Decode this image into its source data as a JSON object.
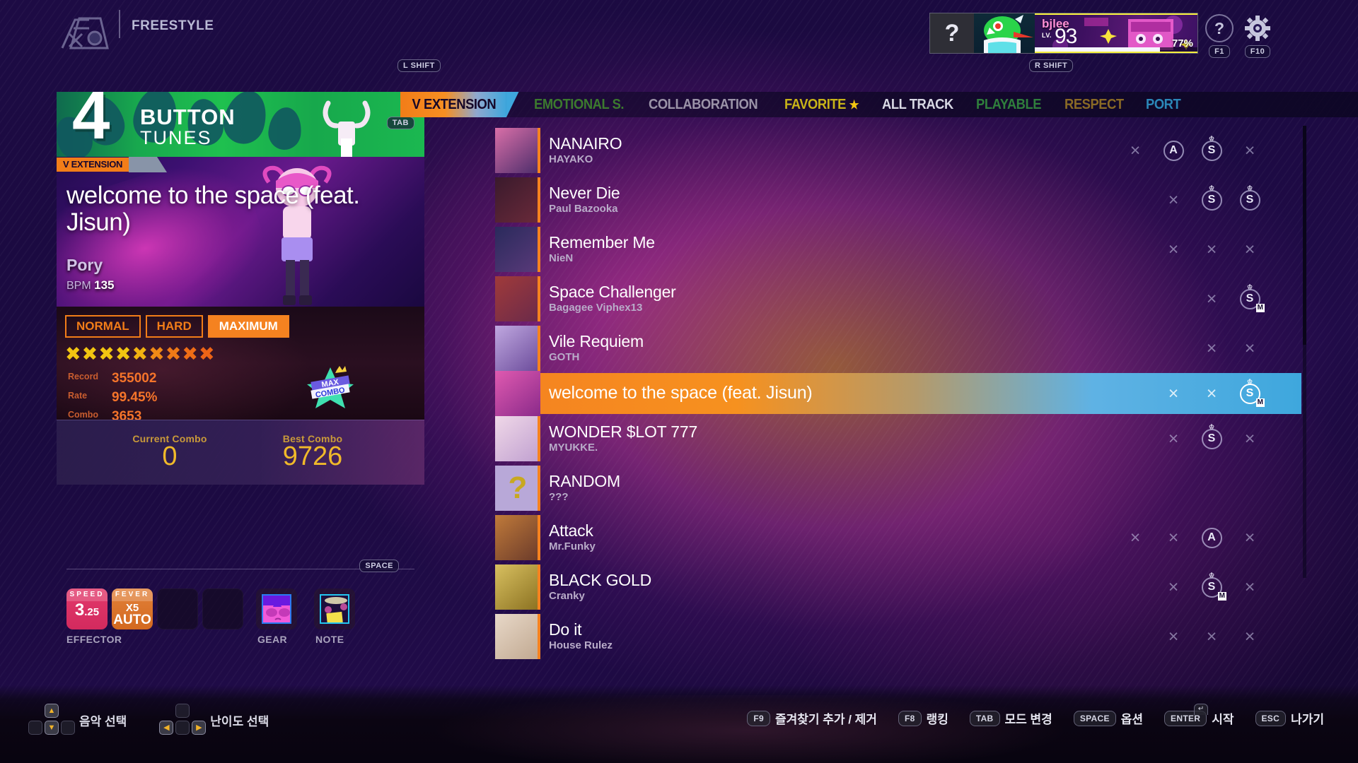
{
  "topbar": {
    "mode_label": "FREESTYLE",
    "mode_icon": "freestyle-mode-icon",
    "help_icon": "question-mark-icon",
    "help_key": "F1",
    "settings_icon": "gear-icon",
    "settings_key": "F10"
  },
  "profile": {
    "unknown_icon": "?",
    "name": "bjlee",
    "lv_label": "LV.",
    "level": "93",
    "percent": "77%",
    "progress": 77
  },
  "tunes": {
    "count": "4",
    "button_label": "BUTTON",
    "tunes_label": "TUNES",
    "tab_key": "TAB"
  },
  "now_playing": {
    "category": "V EXTENSION",
    "title": "welcome to the space (feat. Jisun)",
    "artist": "Pory",
    "bpm_label": "BPM",
    "bpm_value": "135"
  },
  "difficulty": {
    "buttons": [
      {
        "label": "NORMAL",
        "active": false
      },
      {
        "label": "HARD",
        "active": false
      },
      {
        "label": "MAXIMUM",
        "active": true
      }
    ],
    "star_count": 9,
    "star_colors": [
      "#f2c511",
      "#f2c511",
      "#f2c511",
      "#f2c511",
      "#f2b211",
      "#f08a16",
      "#ef7a16",
      "#ee6d16",
      "#ed6416"
    ],
    "records": [
      {
        "label": "Record",
        "value": "355002"
      },
      {
        "label": "Rate",
        "value": "99.45%"
      },
      {
        "label": "Combo",
        "value": "3653"
      }
    ],
    "max_combo_badge": [
      "MAX",
      "COMBO"
    ]
  },
  "combo_panel": {
    "current_label": "Current Combo",
    "current_value": "0",
    "best_label": "Best Combo",
    "best_value": "9726"
  },
  "effector": {
    "space_key": "SPACE",
    "effector_label": "EFFECTOR",
    "gear_label": "GEAR",
    "note_label": "NOTE",
    "speed": {
      "title": "SPEED",
      "value": "3",
      "decimal": ".25"
    },
    "fever": {
      "title": "FEVER",
      "multiplier": "X5",
      "mode": "AUTO"
    }
  },
  "tabs": {
    "left_shift_key": "L SHIFT",
    "right_shift_key": "R SHIFT",
    "items": [
      {
        "label": "V EXTENSION",
        "active": true,
        "color": "#150728"
      },
      {
        "label": "EMOTIONAL S.",
        "active": false,
        "color": "#3c7a2e"
      },
      {
        "label": "COLLABORATION",
        "active": false,
        "color": "#9b93a8"
      },
      {
        "label": "FAVORITE",
        "active": false,
        "color": "#c8b418",
        "star": "★",
        "star_color": "#f2c511"
      },
      {
        "label": "ALL TRACK",
        "active": false,
        "color": "#d8d8e4"
      },
      {
        "label": "PLAYABLE",
        "active": false,
        "color": "#2f7f3c"
      },
      {
        "label": "RESPECT",
        "active": false,
        "color": "#8a6a25"
      },
      {
        "label": "PORT",
        "active": false,
        "color": "#2b87b8"
      }
    ]
  },
  "songlist": [
    {
      "title": "NANAIRO",
      "artist": "HAYAKO",
      "selected": false,
      "marks": [
        {
          "type": "x"
        },
        {
          "type": "rank",
          "label": "A"
        },
        {
          "type": "rank",
          "label": "S",
          "crown": true
        },
        {
          "type": "x"
        }
      ]
    },
    {
      "title": "Never Die",
      "artist": "Paul Bazooka",
      "selected": false,
      "marks": [
        {
          "type": "x"
        },
        {
          "type": "rank",
          "label": "S",
          "crown": true
        },
        {
          "type": "rank",
          "label": "S",
          "crown": true
        }
      ]
    },
    {
      "title": "Remember Me",
      "artist": "NieN",
      "selected": false,
      "marks": [
        {
          "type": "x"
        },
        {
          "type": "x"
        },
        {
          "type": "x"
        }
      ]
    },
    {
      "title": "Space Challenger",
      "artist": "Bagagee Viphex13",
      "selected": false,
      "marks": [
        {
          "type": "x"
        },
        {
          "type": "rank",
          "label": "S",
          "crown": true,
          "sub": "M"
        }
      ]
    },
    {
      "title": "Vile Requiem",
      "artist": "GOTH",
      "selected": false,
      "marks": [
        {
          "type": "x"
        },
        {
          "type": "x"
        }
      ]
    },
    {
      "title": "welcome to the space (feat. Jisun)",
      "artist": "",
      "selected": true,
      "marks": [
        {
          "type": "x"
        },
        {
          "type": "x"
        },
        {
          "type": "rank",
          "label": "S",
          "crown": true,
          "sub": "M"
        }
      ]
    },
    {
      "title": "WONDER $LOT 777",
      "artist": "MYUKKE.",
      "selected": false,
      "marks": [
        {
          "type": "x"
        },
        {
          "type": "rank",
          "label": "S",
          "crown": true
        },
        {
          "type": "x"
        }
      ]
    },
    {
      "title": "RANDOM",
      "artist": "???",
      "selected": false,
      "marks": []
    },
    {
      "title": "Attack",
      "artist": "Mr.Funky",
      "selected": false,
      "marks": [
        {
          "type": "x"
        },
        {
          "type": "x"
        },
        {
          "type": "rank",
          "label": "A"
        },
        {
          "type": "x"
        }
      ]
    },
    {
      "title": "BLACK GOLD",
      "artist": "Cranky",
      "selected": false,
      "marks": [
        {
          "type": "x"
        },
        {
          "type": "rank",
          "label": "S",
          "crown": true,
          "sub": "M"
        },
        {
          "type": "x"
        }
      ]
    },
    {
      "title": "Do it",
      "artist": "House Rulez",
      "selected": false,
      "marks": [
        {
          "type": "x"
        },
        {
          "type": "x"
        },
        {
          "type": "x"
        }
      ]
    }
  ],
  "bottombar": {
    "nav": [
      {
        "label": "음악 선택",
        "keys": "updown"
      },
      {
        "label": "난이도 선택",
        "keys": "leftright"
      }
    ],
    "hints": [
      {
        "key": "F9",
        "label": "즐겨찾기 추가 / 제거"
      },
      {
        "key": "F8",
        "label": "랭킹"
      },
      {
        "key": "TAB",
        "label": "모드 변경"
      },
      {
        "key": "SPACE",
        "label": "옵션"
      },
      {
        "key": "ENTER",
        "label": "시작"
      },
      {
        "key": "ESC",
        "label": "나가기"
      }
    ]
  },
  "colors": {
    "accent_orange": "#f58220",
    "accent_blue": "#3ea7dd",
    "gold": "#f0b92a",
    "panel_purple": "#2c1e4d"
  }
}
